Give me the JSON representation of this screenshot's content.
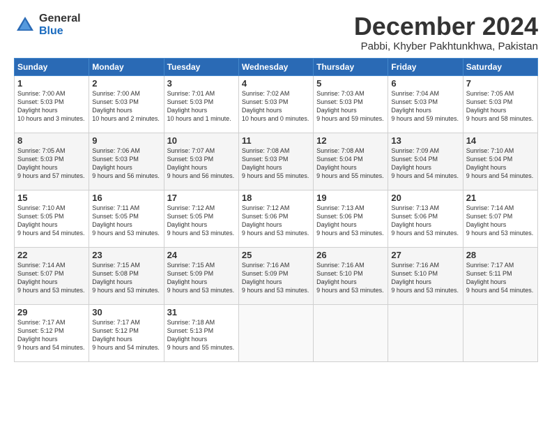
{
  "app": {
    "logo_general": "General",
    "logo_blue": "Blue",
    "title": "December 2024",
    "subtitle": "Pabbi, Khyber Pakhtunkhwa, Pakistan"
  },
  "calendar": {
    "headers": [
      "Sunday",
      "Monday",
      "Tuesday",
      "Wednesday",
      "Thursday",
      "Friday",
      "Saturday"
    ],
    "weeks": [
      [
        null,
        {
          "day": 2,
          "sunrise": "7:00 AM",
          "sunset": "5:03 PM",
          "daylight": "10 hours and 2 minutes."
        },
        {
          "day": 3,
          "sunrise": "7:01 AM",
          "sunset": "5:03 PM",
          "daylight": "10 hours and 1 minute."
        },
        {
          "day": 4,
          "sunrise": "7:02 AM",
          "sunset": "5:03 PM",
          "daylight": "10 hours and 0 minutes."
        },
        {
          "day": 5,
          "sunrise": "7:03 AM",
          "sunset": "5:03 PM",
          "daylight": "9 hours and 59 minutes."
        },
        {
          "day": 6,
          "sunrise": "7:04 AM",
          "sunset": "5:03 PM",
          "daylight": "9 hours and 59 minutes."
        },
        {
          "day": 7,
          "sunrise": "7:05 AM",
          "sunset": "5:03 PM",
          "daylight": "9 hours and 58 minutes."
        }
      ],
      [
        {
          "day": 1,
          "sunrise": "7:00 AM",
          "sunset": "5:03 PM",
          "daylight": "10 hours and 3 minutes.",
          "is_first_row": true
        },
        {
          "day": 8,
          "sunrise": "7:05 AM",
          "sunset": "5:03 PM",
          "daylight": "9 hours and 57 minutes."
        },
        {
          "day": 9,
          "sunrise": "7:06 AM",
          "sunset": "5:03 PM",
          "daylight": "9 hours and 56 minutes."
        },
        {
          "day": 10,
          "sunrise": "7:07 AM",
          "sunset": "5:03 PM",
          "daylight": "9 hours and 56 minutes."
        },
        {
          "day": 11,
          "sunrise": "7:08 AM",
          "sunset": "5:03 PM",
          "daylight": "9 hours and 55 minutes."
        },
        {
          "day": 12,
          "sunrise": "7:08 AM",
          "sunset": "5:04 PM",
          "daylight": "9 hours and 55 minutes."
        },
        {
          "day": 13,
          "sunrise": "7:09 AM",
          "sunset": "5:04 PM",
          "daylight": "9 hours and 54 minutes."
        },
        {
          "day": 14,
          "sunrise": "7:10 AM",
          "sunset": "5:04 PM",
          "daylight": "9 hours and 54 minutes."
        }
      ],
      [
        {
          "day": 15,
          "sunrise": "7:10 AM",
          "sunset": "5:05 PM",
          "daylight": "9 hours and 54 minutes."
        },
        {
          "day": 16,
          "sunrise": "7:11 AM",
          "sunset": "5:05 PM",
          "daylight": "9 hours and 53 minutes."
        },
        {
          "day": 17,
          "sunrise": "7:12 AM",
          "sunset": "5:05 PM",
          "daylight": "9 hours and 53 minutes."
        },
        {
          "day": 18,
          "sunrise": "7:12 AM",
          "sunset": "5:06 PM",
          "daylight": "9 hours and 53 minutes."
        },
        {
          "day": 19,
          "sunrise": "7:13 AM",
          "sunset": "5:06 PM",
          "daylight": "9 hours and 53 minutes."
        },
        {
          "day": 20,
          "sunrise": "7:13 AM",
          "sunset": "5:06 PM",
          "daylight": "9 hours and 53 minutes."
        },
        {
          "day": 21,
          "sunrise": "7:14 AM",
          "sunset": "5:07 PM",
          "daylight": "9 hours and 53 minutes."
        }
      ],
      [
        {
          "day": 22,
          "sunrise": "7:14 AM",
          "sunset": "5:07 PM",
          "daylight": "9 hours and 53 minutes."
        },
        {
          "day": 23,
          "sunrise": "7:15 AM",
          "sunset": "5:08 PM",
          "daylight": "9 hours and 53 minutes."
        },
        {
          "day": 24,
          "sunrise": "7:15 AM",
          "sunset": "5:09 PM",
          "daylight": "9 hours and 53 minutes."
        },
        {
          "day": 25,
          "sunrise": "7:16 AM",
          "sunset": "5:09 PM",
          "daylight": "9 hours and 53 minutes."
        },
        {
          "day": 26,
          "sunrise": "7:16 AM",
          "sunset": "5:10 PM",
          "daylight": "9 hours and 53 minutes."
        },
        {
          "day": 27,
          "sunrise": "7:16 AM",
          "sunset": "5:10 PM",
          "daylight": "9 hours and 53 minutes."
        },
        {
          "day": 28,
          "sunrise": "7:17 AM",
          "sunset": "5:11 PM",
          "daylight": "9 hours and 54 minutes."
        }
      ],
      [
        {
          "day": 29,
          "sunrise": "7:17 AM",
          "sunset": "5:12 PM",
          "daylight": "9 hours and 54 minutes."
        },
        {
          "day": 30,
          "sunrise": "7:17 AM",
          "sunset": "5:12 PM",
          "daylight": "9 hours and 54 minutes."
        },
        {
          "day": 31,
          "sunrise": "7:18 AM",
          "sunset": "5:13 PM",
          "daylight": "9 hours and 55 minutes."
        },
        null,
        null,
        null,
        null
      ]
    ]
  }
}
